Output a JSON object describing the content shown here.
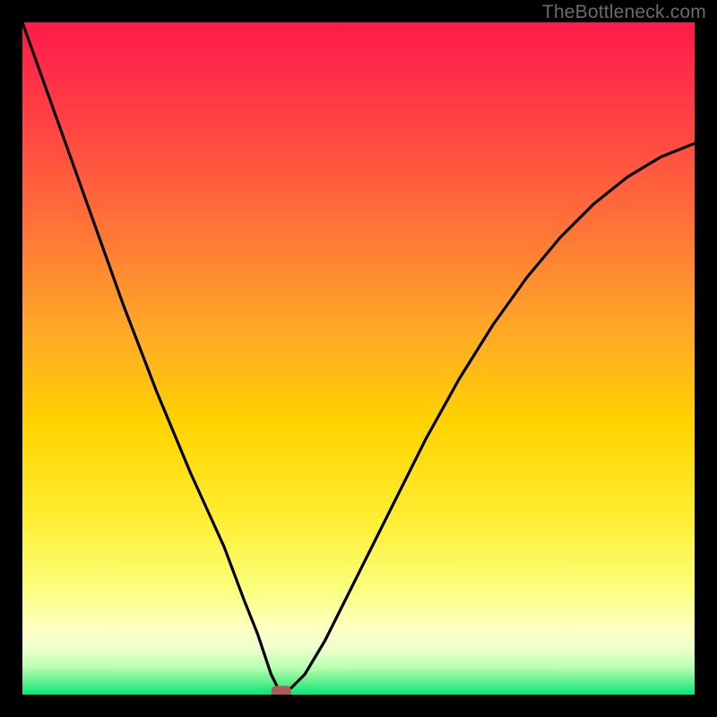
{
  "watermark": "TheBottleneck.com",
  "chart_data": {
    "type": "line",
    "title": "",
    "xlabel": "",
    "ylabel": "",
    "xlim": [
      0,
      100
    ],
    "ylim": [
      0,
      100
    ],
    "background_gradient": {
      "top": "#ff1a4a",
      "upper_mid": "#ff7a33",
      "mid": "#ffd400",
      "lower_mid": "#f6ff66",
      "near_bottom": "#ffffbb",
      "bottom": "#00e878"
    },
    "series": [
      {
        "name": "bottleneck-curve",
        "x": [
          0,
          5,
          10,
          15,
          20,
          25,
          30,
          33,
          35,
          36,
          37,
          38,
          39,
          40,
          42,
          45,
          48,
          52,
          56,
          60,
          65,
          70,
          75,
          80,
          85,
          90,
          95,
          100
        ],
        "y": [
          100,
          86,
          72,
          58,
          45,
          33,
          22,
          14,
          9,
          6,
          3,
          1,
          0.5,
          1,
          3,
          8,
          14,
          22,
          30,
          38,
          47,
          55,
          62,
          68,
          73,
          77,
          80,
          82
        ]
      }
    ],
    "marker": {
      "name": "optimal-point",
      "x": 38.5,
      "y": 0.5,
      "color": "#b25a5a",
      "shape": "rounded-rect"
    }
  }
}
